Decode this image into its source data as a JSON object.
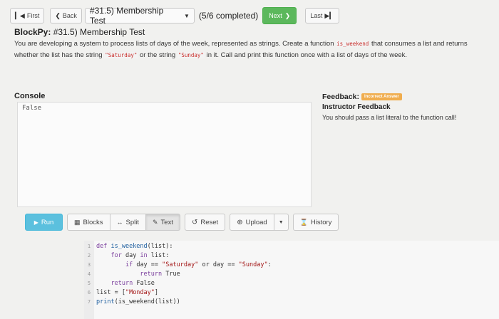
{
  "nav": {
    "first": "First",
    "back": "Back",
    "selected_problem": "#31.5) Membership Test",
    "completed": "(5/6 completed)",
    "next": "Next",
    "last": "Last"
  },
  "problem": {
    "title_bold": "BlockPy:",
    "title_rest": " #31.5) Membership Test",
    "desc_1": "You are developing a system to process lists of days of the week, represented as strings. Create a function ",
    "func_name": "is_weekend",
    "desc_2": " that consumes a list and returns whether the list has the string ",
    "saturday": "\"Saturday\"",
    "desc_3": " or the string ",
    "sunday": "\"Sunday\"",
    "desc_4": " in it. Call and print this function once with a list of days of the week."
  },
  "console": {
    "label": "Console",
    "output": "False"
  },
  "feedback": {
    "label": "Feedback:",
    "badge": "Incorrect Answer",
    "badge_color": "#f0ad4e",
    "subtitle": "Instructor Feedback",
    "message": "You should pass a list literal to the function call!"
  },
  "toolbar": {
    "run": "Run",
    "blocks": "Blocks",
    "split": "Split",
    "text": "Text",
    "reset": "Reset",
    "upload": "Upload",
    "history": "History",
    "run_color": "#5bc0de",
    "next_color": "#5cb85c"
  },
  "code": {
    "lines": [
      {
        "n": "1"
      },
      {
        "n": "2"
      },
      {
        "n": "3"
      },
      {
        "n": "4"
      },
      {
        "n": "5"
      },
      {
        "n": "6"
      },
      {
        "n": "7"
      }
    ],
    "l1": {
      "a": "def ",
      "b": "is_weekend",
      "c": "(list):"
    },
    "l2": {
      "a": "    ",
      "b": "for",
      "c": " day ",
      "d": "in",
      "e": " list:"
    },
    "l3": {
      "a": "        ",
      "b": "if",
      "c": " day == ",
      "d": "\"Saturday\"",
      "e": " or day == ",
      "f": "\"Sunday\"",
      "g": ":"
    },
    "l4": {
      "a": "            ",
      "b": "return",
      "c": " True"
    },
    "l5": {
      "a": "    ",
      "b": "return",
      "c": " False"
    },
    "l6": {
      "a": "list = [",
      "b": "\"Monday\"",
      "c": "]"
    },
    "l7": {
      "a": "print",
      "b": "(is_weekend(list))"
    }
  }
}
